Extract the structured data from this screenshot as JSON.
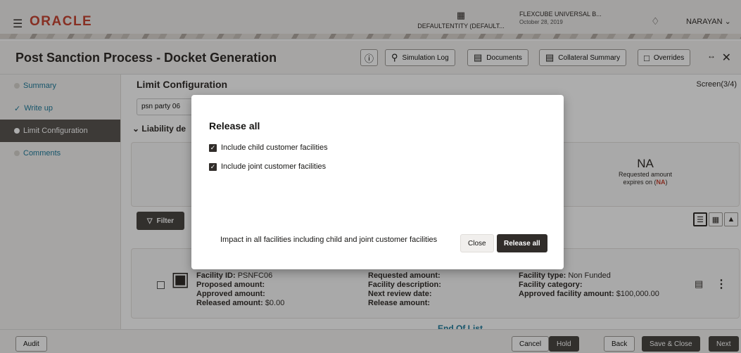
{
  "header": {
    "logo": "ORACLE",
    "entity": "DEFAULTENTITY (DEFAULT...",
    "app_name": "FLEXCUBE UNIVERSAL B...",
    "app_date": "October 28, 2019",
    "user": "NARAYAN"
  },
  "titlebar": {
    "title": "Post Sanction Process - Docket Generation",
    "buttons": [
      "Simulation Log",
      "Documents",
      "Collateral Summary",
      "Overrides"
    ]
  },
  "sidebar": {
    "items": [
      {
        "label": "Summary"
      },
      {
        "label": "Write up"
      },
      {
        "label": "Limit Configuration"
      },
      {
        "label": "Comments"
      }
    ]
  },
  "main": {
    "section_title": "Limit Configuration",
    "screen_indicator": "Screen(3/4)",
    "party_value": "psn party 06",
    "liability_label": "Liability de",
    "na_value": "NA",
    "na_line1": "Requested amount",
    "na_line2_prefix": "expires on (",
    "na_line2_value": "NA",
    "na_line2_suffix": ")",
    "filter_label": "Filter",
    "end_of_list": "End Of List"
  },
  "facility": {
    "col1": [
      {
        "label": "Facility ID:",
        "value": "PSNFC06"
      },
      {
        "label": "Proposed amount:",
        "value": ""
      },
      {
        "label": "Approved amount:",
        "value": ""
      },
      {
        "label": "Released amount:",
        "value": "$0.00"
      }
    ],
    "col2": [
      {
        "label": "Requested amount:",
        "value": ""
      },
      {
        "label": "Facility description:",
        "value": ""
      },
      {
        "label": "Next review date:",
        "value": ""
      },
      {
        "label": "Release amount:",
        "value": ""
      }
    ],
    "col3": [
      {
        "label": "Facility type:",
        "value": "Non Funded"
      },
      {
        "label": "Facility category:",
        "value": ""
      },
      {
        "label": "Approved facility amount:",
        "value": "$100,000.00"
      }
    ]
  },
  "footer": {
    "audit": "Audit",
    "cancel": "Cancel",
    "hold": "Hold",
    "back": "Back",
    "save_close": "Save & Close",
    "next": "Next"
  },
  "dialog": {
    "title": "Release all",
    "option1": "Include child customer facilities",
    "option2": "Include joint customer facilities",
    "option1_checked": true,
    "option2_checked": true,
    "impact_text": "Impact in all facilities including child and joint customer facilities",
    "close_label": "Close",
    "release_label": "Release all"
  }
}
